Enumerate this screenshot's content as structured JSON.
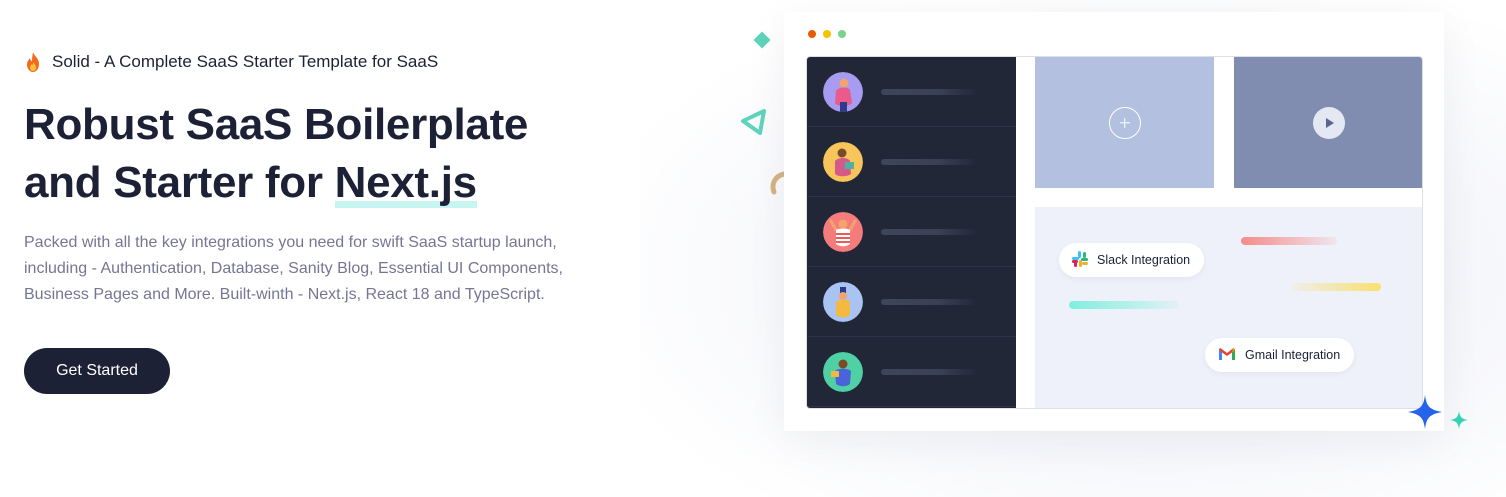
{
  "hero": {
    "eyebrow_icon": "fire-icon",
    "eyebrow": "Solid - A Complete SaaS Starter Template for SaaS",
    "title_line1": "Robust SaaS Boilerplate",
    "title_line2_prefix": "and Starter for ",
    "title_highlight": "Next.js",
    "description": "Packed with all the key integrations you need for swift SaaS startup launch, including - Authentication, Database, Sanity Blog, Essential UI Components, Business Pages and More. Built-winth - Next.js, React 18 and TypeScript.",
    "cta_label": "Get Started"
  },
  "mockup": {
    "window_dots": [
      "#e85d04",
      "#f5c400",
      "#7bd389"
    ],
    "sidebar_avatars": [
      "avatar-purple",
      "avatar-yellow",
      "avatar-red",
      "avatar-blue",
      "avatar-green"
    ],
    "integrations": [
      {
        "label": "Slack Integration",
        "icon": "slack-icon"
      },
      {
        "label": "Gmail Integration",
        "icon": "gmail-icon"
      }
    ]
  },
  "colors": {
    "primary_dark": "#1c2136",
    "text_muted": "#757693",
    "highlight": "#c7f6f2",
    "accent_blue": "#2563eb",
    "accent_teal": "#33d1b5"
  }
}
